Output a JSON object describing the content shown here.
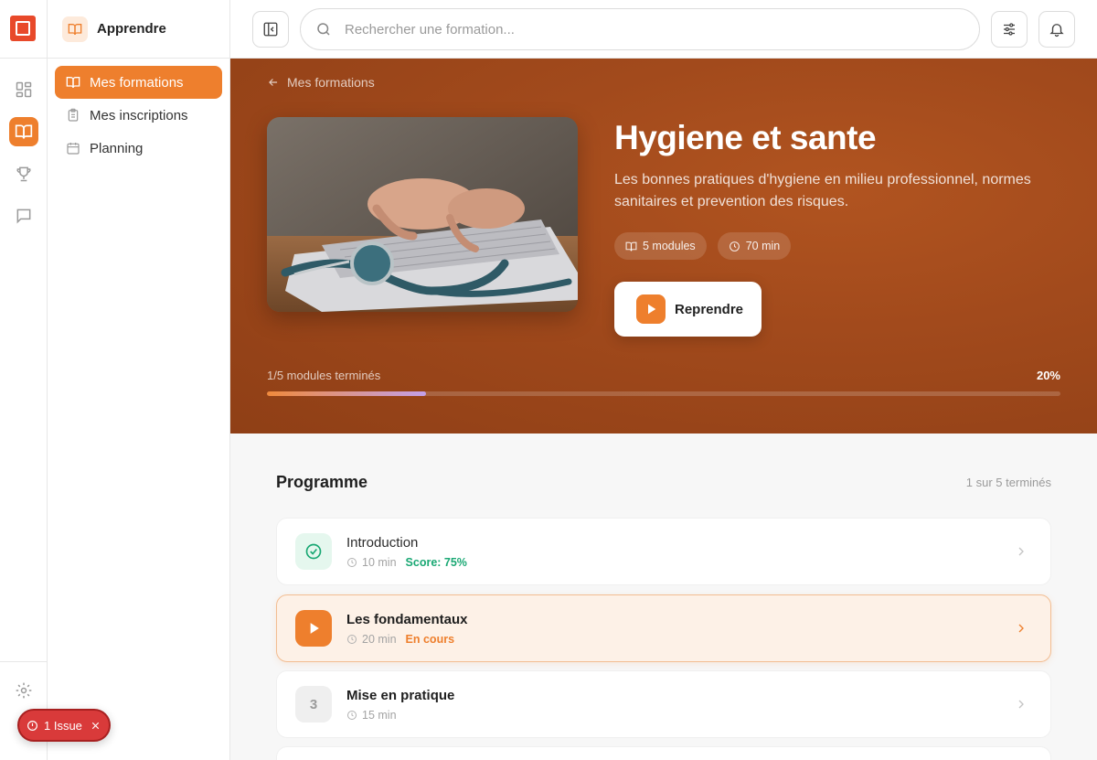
{
  "app": {
    "section_title": "Apprendre"
  },
  "sidebar": {
    "items": [
      {
        "label": "Mes formations",
        "active": true,
        "icon": "book-icon"
      },
      {
        "label": "Mes inscriptions",
        "active": false,
        "icon": "clipboard-icon"
      },
      {
        "label": "Planning",
        "active": false,
        "icon": "calendar-icon"
      }
    ]
  },
  "rail": {
    "items": [
      "dashboard-icon",
      "book-icon",
      "trophy-icon",
      "chat-icon"
    ],
    "bottom": [
      "settings-icon"
    ]
  },
  "search": {
    "placeholder": "Rechercher une formation..."
  },
  "course": {
    "back_label": "Mes formations",
    "title": "Hygiene et sante",
    "description": "Les bonnes pratiques d'hygiene en milieu professionnel, normes sanitaires et prevention des risques.",
    "modules_chip": "5 modules",
    "duration_chip": "70 min",
    "resume_label": "Reprendre",
    "progress_label": "1/5 modules terminés",
    "progress_percent_label": "20%",
    "progress_fraction": 0.2
  },
  "programme": {
    "title": "Programme",
    "count": "1 sur 5 terminés",
    "modules": [
      {
        "title": "Introduction",
        "duration": "10 min",
        "tag": "Score: 75%",
        "status": "done"
      },
      {
        "title": "Les fondamentaux",
        "duration": "20 min",
        "tag": "En cours",
        "status": "current"
      },
      {
        "title": "Mise en pratique",
        "duration": "15 min",
        "number": "3",
        "status": "todo"
      }
    ]
  },
  "issue": {
    "label": "1 Issue"
  },
  "colors": {
    "accent": "#ee7f2d",
    "hero_bg": "#a24a1c",
    "success": "#1aa874",
    "danger": "#d93a3a"
  }
}
